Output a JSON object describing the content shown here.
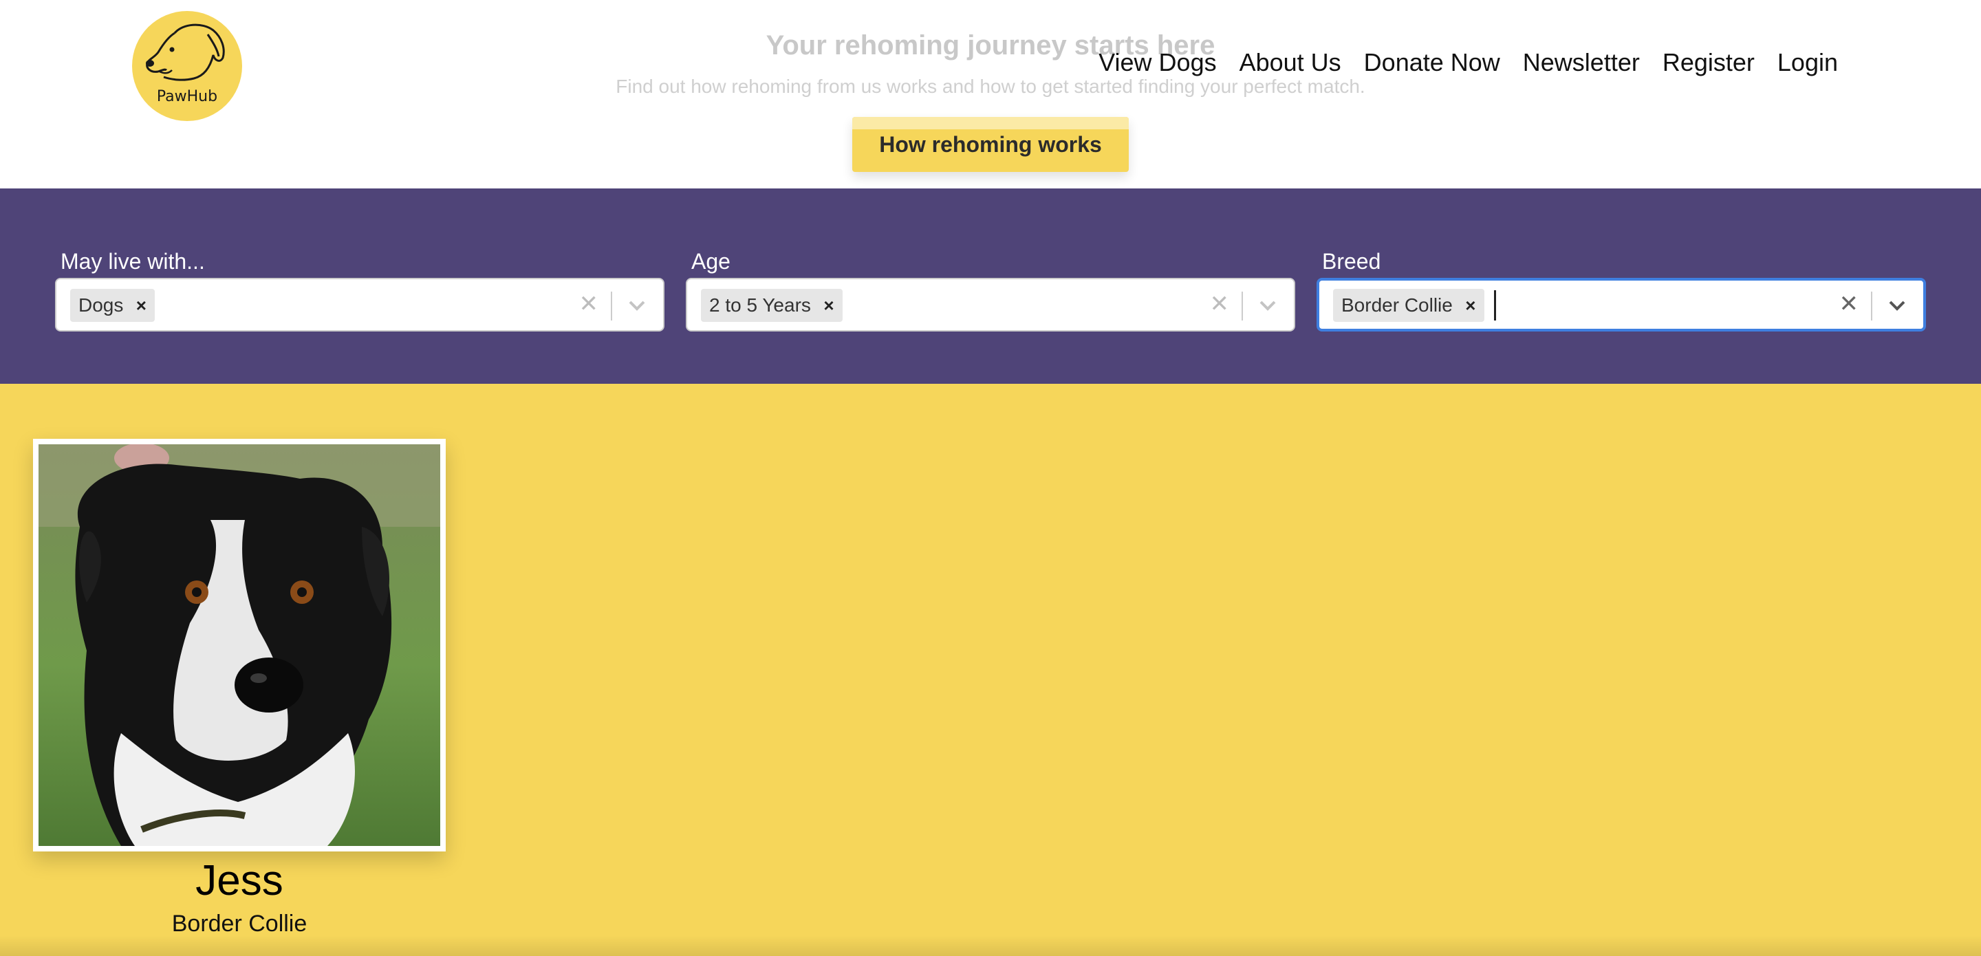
{
  "logo": {
    "text": "PawHub"
  },
  "hero": {
    "title": "Your rehoming journey starts here",
    "subtitle": "Find out how rehoming from us works and how to get started finding your perfect match.",
    "button_label": "How rehoming works"
  },
  "nav": {
    "items": [
      {
        "label": "View Dogs"
      },
      {
        "label": "About Us"
      },
      {
        "label": "Donate Now"
      },
      {
        "label": "Newsletter"
      },
      {
        "label": "Register"
      },
      {
        "label": "Login"
      }
    ]
  },
  "filters": {
    "live_with": {
      "label": "May live with...",
      "selected": "Dogs"
    },
    "age": {
      "label": "Age",
      "selected": "2 to 5 Years"
    },
    "breed": {
      "label": "Breed",
      "selected": "Border Collie"
    }
  },
  "results": [
    {
      "name": "Jess",
      "breed": "Border Collie"
    }
  ],
  "colors": {
    "brand_yellow": "#f6d65a",
    "filter_bar_purple": "#4f4478",
    "focus_blue": "#3f7fe0"
  }
}
